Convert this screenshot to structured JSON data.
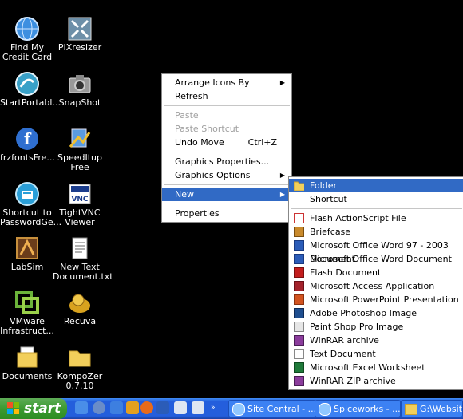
{
  "desktop_icons": [
    {
      "label": "Find My Credit Card",
      "icon": "globe-icon"
    },
    {
      "label": "PIXresizer",
      "icon": "resize-arrows-icon"
    },
    {
      "label": "StartPortabl...",
      "icon": "portable-app-icon"
    },
    {
      "label": "SnapShot",
      "icon": "camera-icon"
    },
    {
      "label": "frzfontsFre...",
      "icon": "font-f-icon"
    },
    {
      "label": "SpeedItup Free",
      "icon": "speeditup-icon"
    },
    {
      "label": "Shortcut to PasswordGe...",
      "icon": "password-generator-icon"
    },
    {
      "label": "TightVNC Viewer",
      "icon": "vnc-icon"
    },
    {
      "label": "LabSim",
      "icon": "labsim-icon"
    },
    {
      "label": "New Text Document.txt",
      "icon": "text-document-icon"
    },
    {
      "label": "VMware Infrastruct...",
      "icon": "vmware-icon"
    },
    {
      "label": "Recuva",
      "icon": "recuva-icon"
    },
    {
      "label": "Documents",
      "icon": "documents-folder-icon"
    },
    {
      "label": "KompoZer 0.7.10",
      "icon": "folder-icon"
    }
  ],
  "context_menu": {
    "items": [
      {
        "label": "Arrange Icons By",
        "submenu": true
      },
      {
        "label": "Refresh"
      },
      {
        "label": "Paste",
        "disabled": true
      },
      {
        "label": "Paste Shortcut",
        "disabled": true
      },
      {
        "label": "Undo Move",
        "shortcut": "Ctrl+Z"
      },
      {
        "label": "Graphics Properties..."
      },
      {
        "label": "Graphics Options",
        "submenu": true
      },
      {
        "label": "New",
        "submenu": true,
        "highlighted": true
      },
      {
        "label": "Properties"
      }
    ]
  },
  "new_submenu": {
    "items": [
      {
        "label": "Folder",
        "icon": "folder-icon",
        "highlighted": true
      },
      {
        "label": "Shortcut",
        "icon": "shortcut-icon"
      },
      {
        "label": "Flash ActionScript File",
        "icon": "flash-as-icon"
      },
      {
        "label": "Briefcase",
        "icon": "briefcase-icon"
      },
      {
        "label": "Microsoft Office Word 97 - 2003 Document",
        "icon": "word-icon"
      },
      {
        "label": "Microsoft Office Word Document",
        "icon": "word-icon"
      },
      {
        "label": "Flash Document",
        "icon": "flash-icon"
      },
      {
        "label": "Microsoft Access Application",
        "icon": "access-icon"
      },
      {
        "label": "Microsoft PowerPoint Presentation",
        "icon": "powerpoint-icon"
      },
      {
        "label": "Adobe Photoshop Image",
        "icon": "photoshop-icon"
      },
      {
        "label": "Paint Shop Pro Image",
        "icon": "paintshop-icon"
      },
      {
        "label": "WinRAR archive",
        "icon": "winrar-icon"
      },
      {
        "label": "Text Document",
        "icon": "text-document-icon"
      },
      {
        "label": "Microsoft Excel Worksheet",
        "icon": "excel-icon"
      },
      {
        "label": "WinRAR ZIP archive",
        "icon": "winrar-zip-icon"
      }
    ]
  },
  "taskbar": {
    "start_label": "start",
    "tasks": [
      {
        "label": "Site Central - ...",
        "icon": "ie-icon"
      },
      {
        "label": "Spiceworks - ...",
        "icon": "ie-icon"
      },
      {
        "label": "G:\\Website ...",
        "icon": "folder-icon"
      }
    ]
  },
  "colors": {
    "highlight": "#316ac5",
    "taskbar": "#245edc",
    "start_button": "#3c9a31"
  }
}
